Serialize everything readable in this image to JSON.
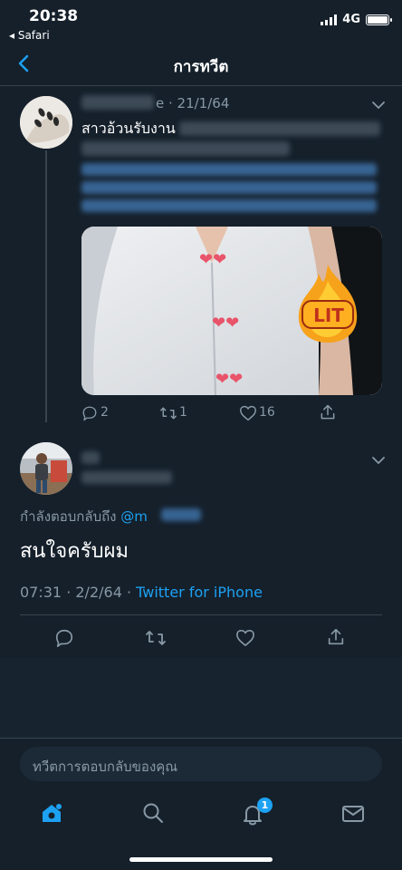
{
  "status_bar": {
    "time": "20:38",
    "back_app": "◂ Safari",
    "network": "4G"
  },
  "header": {
    "title": "การทวีต"
  },
  "original_tweet": {
    "handle_suffix": "e",
    "date": "· 21/1/64",
    "text_visible": "สาวอ้วนรับงาน",
    "sticker_text": "LIT",
    "actions": {
      "reply_count": "2",
      "retweet_count": "1",
      "like_count": "16"
    }
  },
  "reply_tweet": {
    "replying_to_label": "กำลังตอบกลับถึง",
    "replying_to_mention": "@m",
    "text": "สนใจครับผม",
    "time": "07:31 · 2/2/64 · ",
    "source": "Twitter for iPhone"
  },
  "composer": {
    "placeholder": "ทวีตการตอบกลับของคุณ"
  },
  "tab_bar": {
    "notification_badge": "1"
  },
  "colors": {
    "background": "#15202b",
    "accent": "#1da1f2",
    "secondary_text": "#8899a6",
    "divider": "#38444d"
  },
  "icons": [
    "back-chevron-icon",
    "chevron-down-icon",
    "reply-icon",
    "retweet-icon",
    "like-icon",
    "share-icon",
    "home-icon",
    "search-icon",
    "notifications-icon",
    "messages-icon"
  ]
}
